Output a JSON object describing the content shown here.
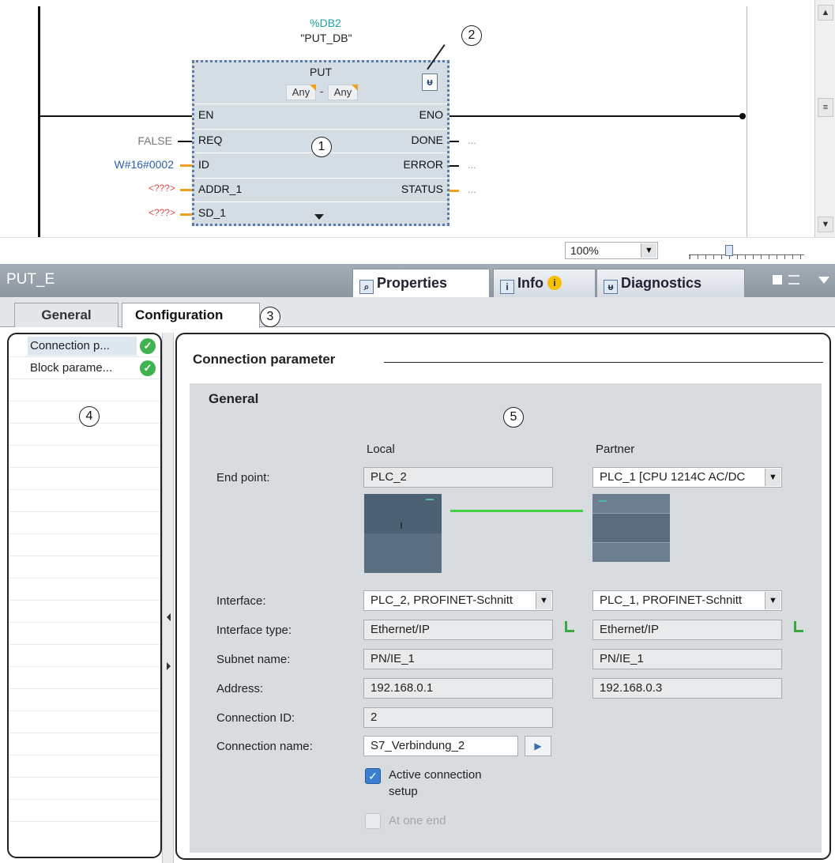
{
  "editor": {
    "db_number": "%DB2",
    "db_name": "\"PUT_DB\"",
    "block_title": "PUT",
    "any_left": "Any",
    "any_sep": "-",
    "any_right": "Any",
    "inputs": [
      {
        "pin": "EN",
        "value": ""
      },
      {
        "pin": "REQ",
        "value": "FALSE"
      },
      {
        "pin": "ID",
        "value": "W#16#0002"
      },
      {
        "pin": "ADDR_1",
        "value": "<???>"
      },
      {
        "pin": "SD_1",
        "value": "<???>"
      }
    ],
    "outputs": [
      {
        "pin": "ENO",
        "value": ""
      },
      {
        "pin": "DONE",
        "value": "..."
      },
      {
        "pin": "ERROR",
        "value": "..."
      },
      {
        "pin": "STATUS",
        "value": "..."
      }
    ],
    "zoom": "100%",
    "colors": {
      "db": "#1aa0a0",
      "id_value": "#2a5fb0",
      "unset": "#e04848",
      "wire": "#f0a020"
    }
  },
  "callouts": [
    "1",
    "2",
    "3",
    "4",
    "5"
  ],
  "properties": {
    "object_name": "PUT_E",
    "tabs": [
      "Properties",
      "Info",
      "Diagnostics"
    ],
    "subtabs": [
      "General",
      "Configuration"
    ]
  },
  "nav": {
    "items": [
      "Connection p...",
      "Block parame..."
    ]
  },
  "form": {
    "section_title": "Connection parameter",
    "group_title": "General",
    "col_local": "Local",
    "col_partner": "Partner",
    "labels": {
      "end_point": "End point:",
      "interface": "Interface:",
      "interface_type": "Interface type:",
      "subnet_name": "Subnet name:",
      "address": "Address:",
      "connection_id": "Connection ID:",
      "connection_name": "Connection name:"
    },
    "local": {
      "end_point": "PLC_2",
      "interface": "PLC_2, PROFINET-Schnitt",
      "interface_type": "Ethernet/IP",
      "subnet_name": "PN/IE_1",
      "address": "192.168.0.1",
      "connection_id": "2",
      "connection_name": "S7_Verbindung_2"
    },
    "partner": {
      "end_point": "PLC_1 [CPU 1214C AC/DC",
      "interface": "PLC_1, PROFINET-Schnitt",
      "interface_type": "Ethernet/IP",
      "subnet_name": "PN/IE_1",
      "address": "192.168.0.3"
    },
    "active_setup_line1": "Active connection",
    "active_setup_line2": "setup",
    "active_setup_checked": true,
    "one_end": "At one end",
    "one_end_checked": false
  }
}
